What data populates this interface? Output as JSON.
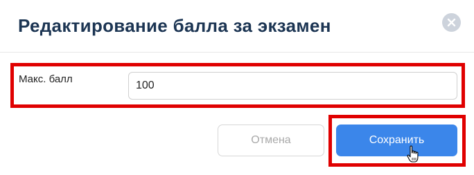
{
  "dialog": {
    "title": "Редактирование балла за экзамен",
    "close_icon": "close-icon"
  },
  "form": {
    "max_score": {
      "label": "Макс. балл",
      "value": "100"
    }
  },
  "actions": {
    "cancel_label": "Отмена",
    "save_label": "Сохранить"
  },
  "colors": {
    "title": "#1c3553",
    "primary": "#3b86ea",
    "highlight": "#e00000",
    "close_bg": "#cdd3dc"
  }
}
